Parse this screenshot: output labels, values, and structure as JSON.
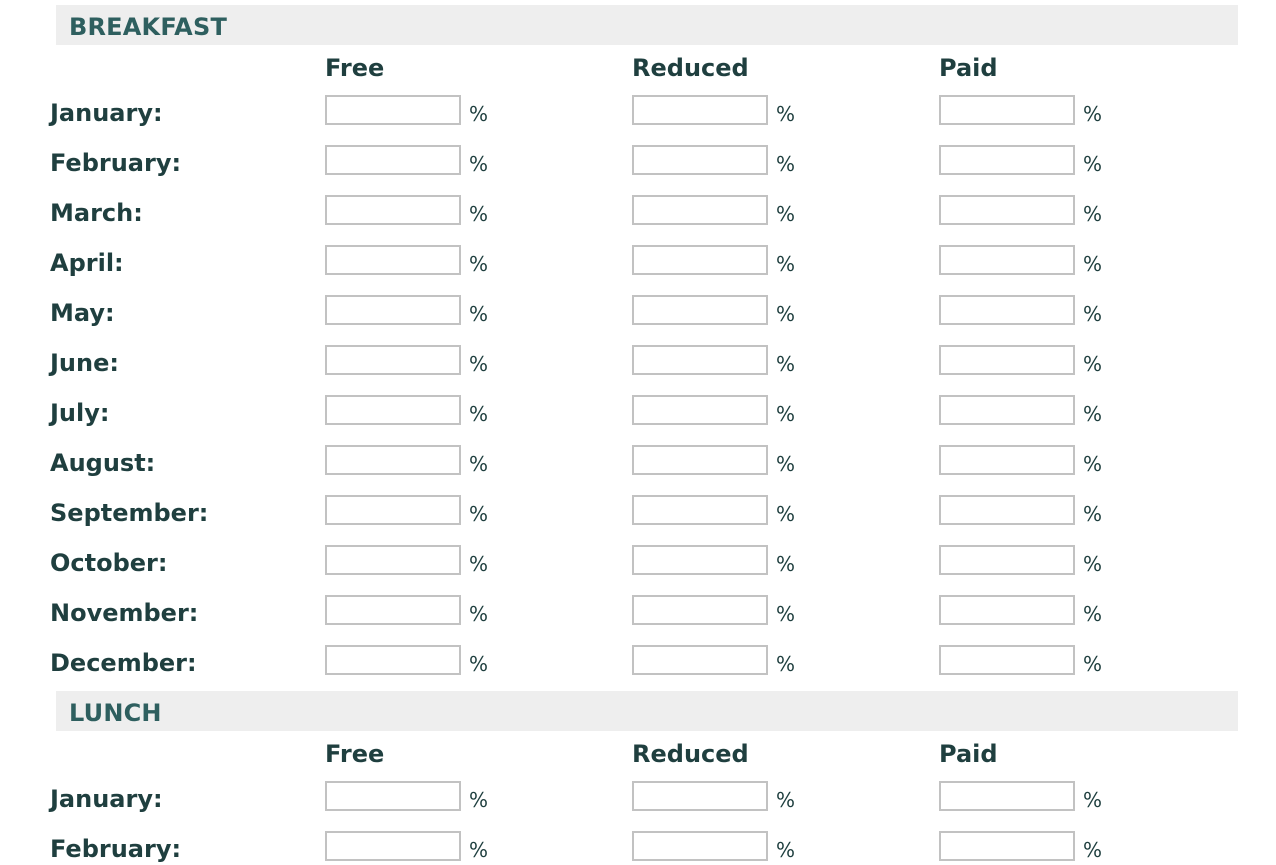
{
  "percent_symbol": "%",
  "sections": [
    {
      "title": "BREAKFAST",
      "columns": [
        "Free",
        "Reduced",
        "Paid"
      ],
      "rows": [
        {
          "label": "January:",
          "values": [
            "",
            "",
            ""
          ]
        },
        {
          "label": "February:",
          "values": [
            "",
            "",
            ""
          ]
        },
        {
          "label": "March:",
          "values": [
            "",
            "",
            ""
          ]
        },
        {
          "label": "April:",
          "values": [
            "",
            "",
            ""
          ]
        },
        {
          "label": "May:",
          "values": [
            "",
            "",
            ""
          ]
        },
        {
          "label": "June:",
          "values": [
            "",
            "",
            ""
          ]
        },
        {
          "label": "July:",
          "values": [
            "",
            "",
            ""
          ]
        },
        {
          "label": "August:",
          "values": [
            "",
            "",
            ""
          ]
        },
        {
          "label": "September:",
          "values": [
            "",
            "",
            ""
          ]
        },
        {
          "label": "October:",
          "values": [
            "",
            "",
            ""
          ]
        },
        {
          "label": "November:",
          "values": [
            "",
            "",
            ""
          ]
        },
        {
          "label": "December:",
          "values": [
            "",
            "",
            ""
          ]
        }
      ]
    },
    {
      "title": "LUNCH",
      "columns": [
        "Free",
        "Reduced",
        "Paid"
      ],
      "rows": [
        {
          "label": "January:",
          "values": [
            "",
            "",
            ""
          ]
        },
        {
          "label": "February:",
          "values": [
            "",
            "",
            ""
          ]
        }
      ]
    }
  ]
}
